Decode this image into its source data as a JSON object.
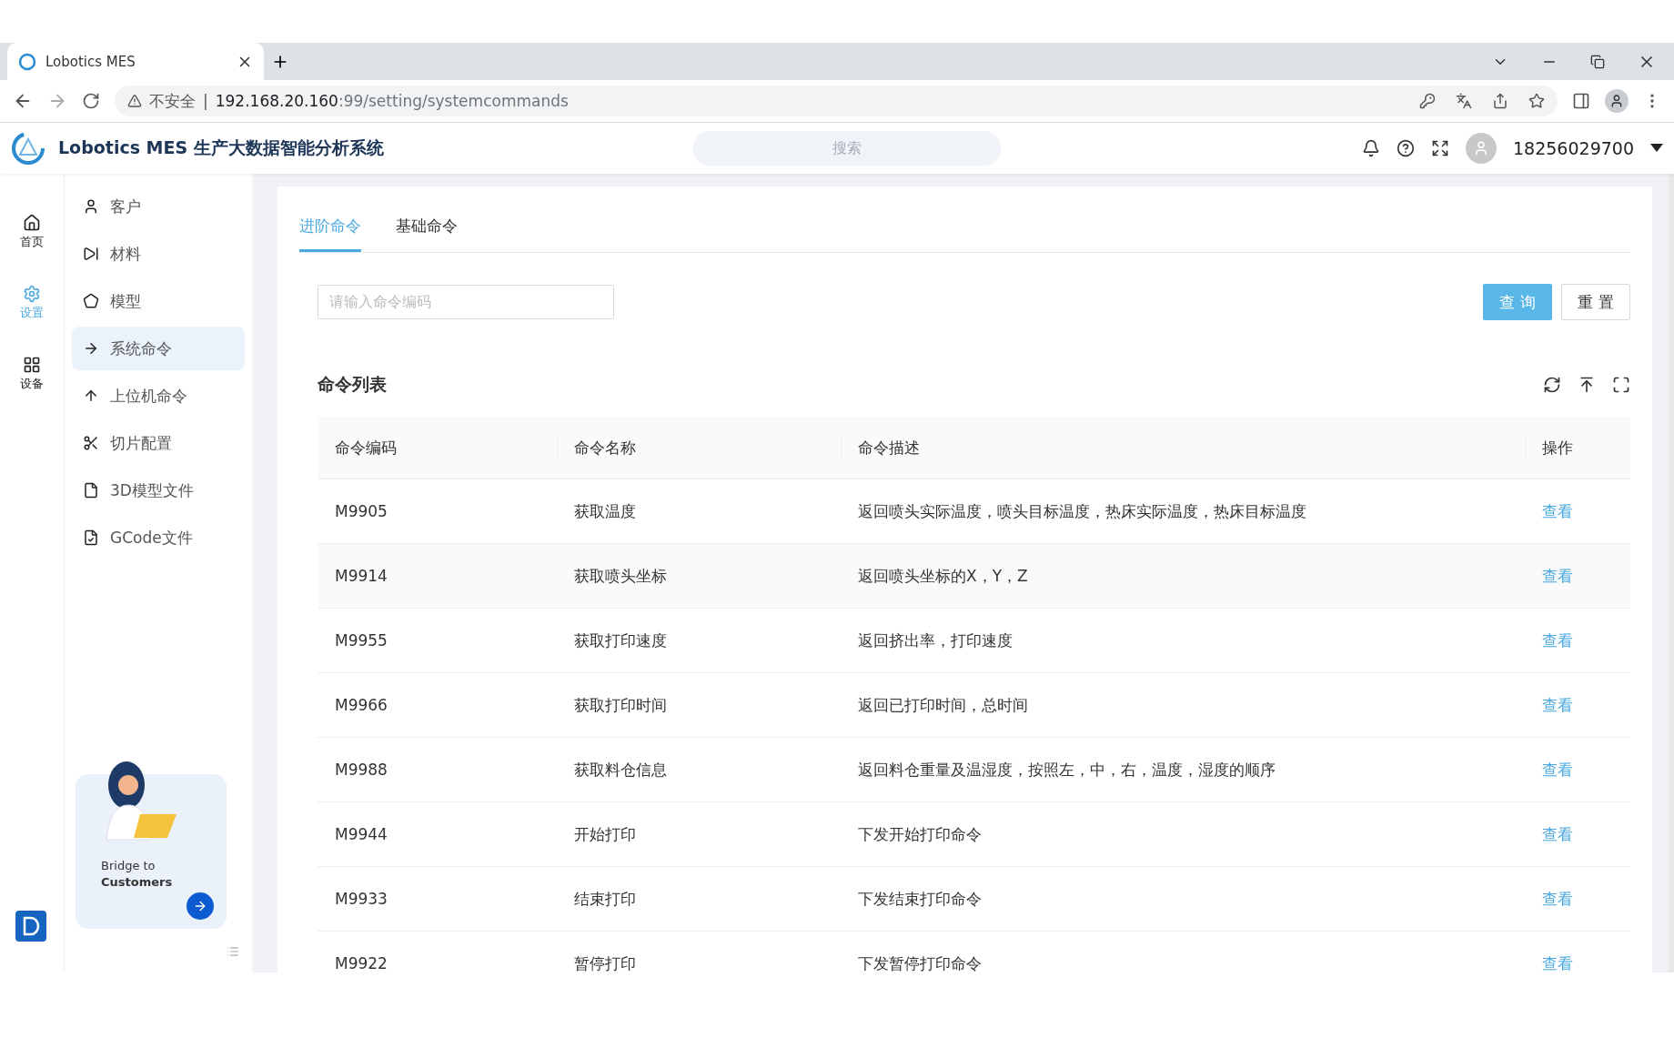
{
  "browser": {
    "tab_title": "Lobotics MES",
    "security": "不安全",
    "separator": "|",
    "url_host": "192.168.20.160",
    "url_rest": ":99/setting/systemcommands"
  },
  "header": {
    "title": "Lobotics MES 生产大数据智能分析系统",
    "search_placeholder": "搜索",
    "user": "18256029700"
  },
  "rail": [
    {
      "label": "首页",
      "selected": false
    },
    {
      "label": "设置",
      "selected": true
    },
    {
      "label": "设备",
      "selected": false
    }
  ],
  "menu": [
    {
      "label": "客户",
      "selected": false
    },
    {
      "label": "材料",
      "selected": false
    },
    {
      "label": "模型",
      "selected": false
    },
    {
      "label": "系统命令",
      "selected": true
    },
    {
      "label": "上位机命令",
      "selected": false
    },
    {
      "label": "切片配置",
      "selected": false
    },
    {
      "label": "3D模型文件",
      "selected": false
    },
    {
      "label": "GCode文件",
      "selected": false
    }
  ],
  "promo": {
    "line1": "Bridge to",
    "line2": "Customers"
  },
  "tabs": [
    {
      "label": "进阶命令",
      "selected": true
    },
    {
      "label": "基础命令",
      "selected": false
    }
  ],
  "filter": {
    "placeholder": "请输入命令编码",
    "buttons": [
      {
        "label": "查 询",
        "kind": "primary"
      },
      {
        "label": "重 置",
        "kind": "default"
      }
    ]
  },
  "table": {
    "title": "命令列表",
    "columns": [
      "命令编码",
      "命令名称",
      "命令描述",
      "操作"
    ],
    "rows": [
      {
        "code": "M9905",
        "name": "获取温度",
        "desc": "返回喷头实际温度，喷头目标温度，热床实际温度，热床目标温度",
        "action": "查看"
      },
      {
        "code": "M9914",
        "name": "获取喷头坐标",
        "desc": "返回喷头坐标的X，Y，Z",
        "action": "查看"
      },
      {
        "code": "M9955",
        "name": "获取打印速度",
        "desc": "返回挤出率，打印速度",
        "action": "查看"
      },
      {
        "code": "M9966",
        "name": "获取打印时间",
        "desc": "返回已打印时间，总时间",
        "action": "查看"
      },
      {
        "code": "M9988",
        "name": "获取料仓信息",
        "desc": "返回料仓重量及温湿度，按照左，中，右，温度，湿度的顺序",
        "action": "查看"
      },
      {
        "code": "M9944",
        "name": "开始打印",
        "desc": "下发开始打印命令",
        "action": "查看"
      },
      {
        "code": "M9933",
        "name": "结束打印",
        "desc": "下发结束打印命令",
        "action": "查看"
      },
      {
        "code": "M9922",
        "name": "暂停打印",
        "desc": "下发暂停打印命令",
        "action": "查看"
      }
    ]
  }
}
